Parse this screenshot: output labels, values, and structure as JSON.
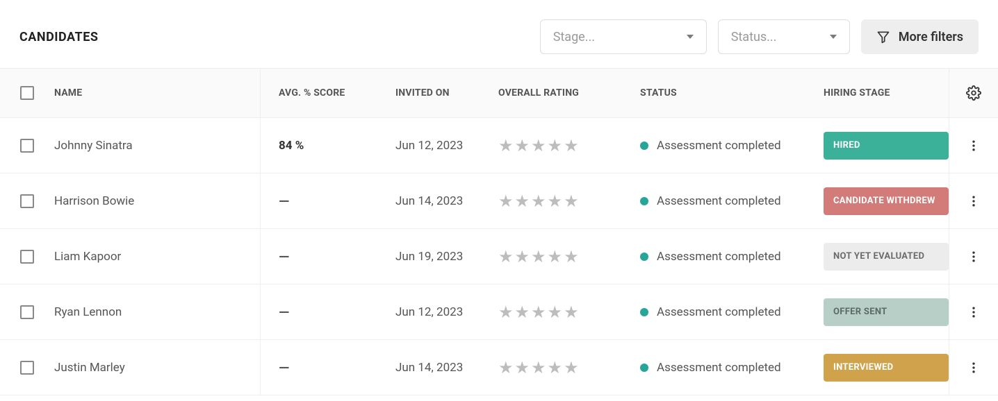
{
  "header": {
    "title": "CANDIDATES",
    "stage_placeholder": "Stage...",
    "status_placeholder": "Status...",
    "more_filters_label": "More filters"
  },
  "columns": {
    "name": "NAME",
    "score": "AVG. % SCORE",
    "invited": "INVITED ON",
    "rating": "OVERALL RATING",
    "status": "STATUS",
    "stage": "HIRING STAGE"
  },
  "status_values": {
    "completed": "Assessment completed"
  },
  "stage_badges": {
    "hired": "HIRED",
    "withdrew": "CANDIDATE WITHDREW",
    "noteval": "NOT YET EVALUATED",
    "offer": "OFFER SENT",
    "interviewed": "INTERVIEWED"
  },
  "rows": [
    {
      "name": "Johnny Sinatra",
      "score": "84 %",
      "invited": "Jun 12, 2023",
      "status_key": "completed",
      "stage_key": "hired",
      "stage_class": "badge-hired"
    },
    {
      "name": "Harrison Bowie",
      "score": "—",
      "invited": "Jun 14, 2023",
      "status_key": "completed",
      "stage_key": "withdrew",
      "stage_class": "badge-withdrew"
    },
    {
      "name": "Liam Kapoor",
      "score": "—",
      "invited": "Jun 19, 2023",
      "status_key": "completed",
      "stage_key": "noteval",
      "stage_class": "badge-noteval"
    },
    {
      "name": "Ryan Lennon",
      "score": "—",
      "invited": "Jun 12, 2023",
      "status_key": "completed",
      "stage_key": "offer",
      "stage_class": "badge-offer"
    },
    {
      "name": "Justin Marley",
      "score": "—",
      "invited": "Jun 14, 2023",
      "status_key": "completed",
      "stage_key": "interviewed",
      "stage_class": "badge-interviewed"
    }
  ]
}
